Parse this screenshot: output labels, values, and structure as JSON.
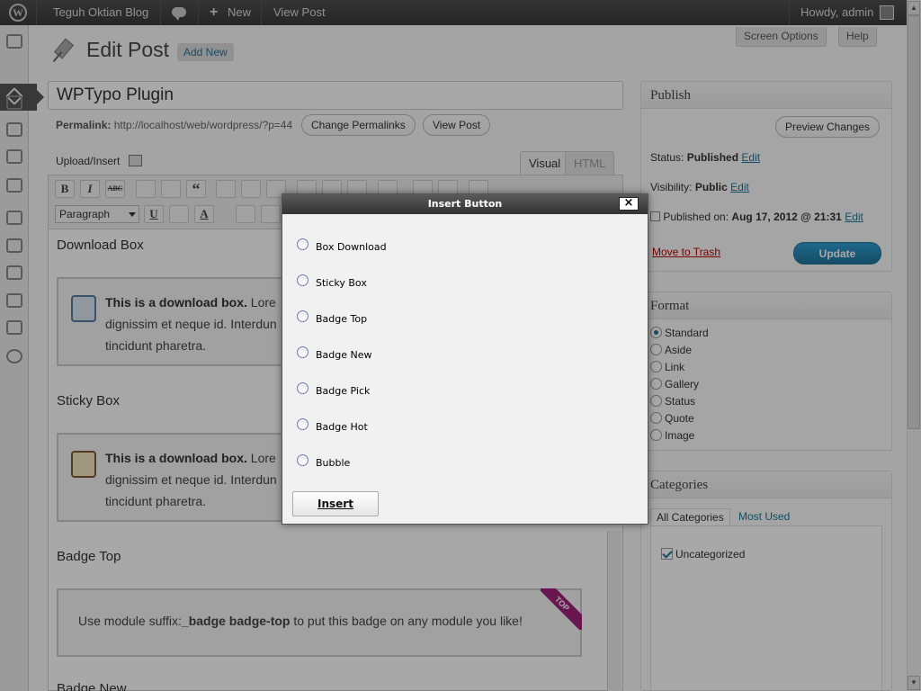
{
  "adminbar": {
    "logo": "W",
    "site_name": "Teguh Oktian Blog",
    "new_label": "New",
    "new_icon": "+",
    "view_post": "View Post",
    "howdy": "Howdy, admin"
  },
  "header": {
    "title": "Edit Post",
    "add_new": "Add New",
    "screen_options": "Screen Options",
    "help": "Help"
  },
  "post": {
    "title": "WPTypo Plugin",
    "permalink_label": "Permalink:",
    "permalink_url": "http://localhost/web/wordpress/?p=44",
    "change_permalinks": "Change Permalinks",
    "view_post": "View Post",
    "upload_insert": "Upload/Insert",
    "tab_visual": "Visual",
    "tab_html": "HTML"
  },
  "toolbar": {
    "bold": "B",
    "italic": "I",
    "strike": "ABC",
    "quote": "“",
    "format_select": "Paragraph",
    "underline": "U",
    "textcolor": "A"
  },
  "editor": {
    "h_download": "Download Box",
    "h_sticky": "Sticky Box",
    "h_badge_top": "Badge Top",
    "h_badge_new": "Badge New",
    "box_bold": "This is a download box.",
    "box_rest1": " Lore",
    "box_line2": "dignissim et neque id. Interdun",
    "box_line3": "tincidunt pharetra.",
    "badge_pre": "Use module suffix:",
    "badge_code": "_badge badge-top",
    "badge_post": " to put this badge on any module you like!",
    "ribbon": "TOP"
  },
  "publish": {
    "title": "Publish",
    "preview": "Preview Changes",
    "status_label": "Status:",
    "status_value": "Published",
    "visibility_label": "Visibility:",
    "visibility_value": "Public",
    "published_label": "Published on:",
    "published_value": "Aug 17, 2012 @ 21:31",
    "edit": "Edit",
    "trash": "Move to Trash",
    "update": "Update"
  },
  "format": {
    "title": "Format",
    "options": [
      "Standard",
      "Aside",
      "Link",
      "Gallery",
      "Status",
      "Quote",
      "Image"
    ],
    "selected": "Standard"
  },
  "categories": {
    "title": "Categories",
    "tab_all": "All Categories",
    "tab_used": "Most Used",
    "items": [
      "Uncategorized"
    ]
  },
  "modal": {
    "title": "Insert Button",
    "close": "×",
    "options": [
      "Box Download",
      "Sticky Box",
      "Badge Top",
      "Badge New",
      "Badge Pick",
      "Badge Hot",
      "Bubble"
    ],
    "insert": "Insert"
  },
  "colors": {
    "link": "#21759b",
    "adminbar": "#464646",
    "update_button": "#21759b",
    "badge_ribbon": "#a0207a",
    "trash": "#bb0000"
  }
}
